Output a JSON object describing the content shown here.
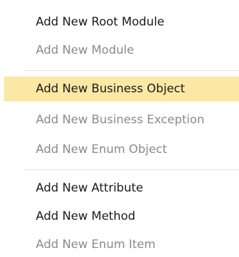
{
  "menu": {
    "items": [
      {
        "label": "Add New Root Module",
        "enabled": true
      },
      {
        "label": "Add New Module",
        "enabled": false
      },
      {
        "label": "Add New Business Object",
        "enabled": true,
        "highlighted": true
      },
      {
        "label": "Add New Business Exception",
        "enabled": false
      },
      {
        "label": "Add New Enum Object",
        "enabled": false
      },
      {
        "label": "Add New Attribute",
        "enabled": true
      },
      {
        "label": "Add New Method",
        "enabled": true
      },
      {
        "label": "Add New Enum Item",
        "enabled": false
      }
    ]
  },
  "colors": {
    "highlight": "#fbe8a4",
    "enabled_text": "#1a1a1a",
    "disabled_text": "#8a8a8a",
    "separator": "#e3e3e3"
  }
}
